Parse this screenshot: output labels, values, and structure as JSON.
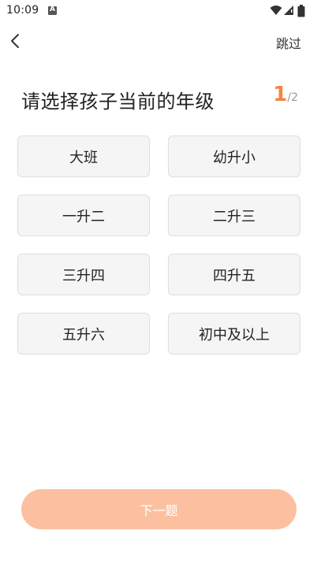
{
  "status_bar": {
    "time": "10:09",
    "icons": [
      "app-notification-icon",
      "wifi-icon",
      "signal-icon",
      "battery-icon"
    ]
  },
  "nav": {
    "back_icon": "chevron-left-icon",
    "skip_label": "跳过"
  },
  "question": {
    "title": "请选择孩子当前的年级",
    "step_current": "1",
    "step_total": "/2"
  },
  "options": [
    "大班",
    "幼升小",
    "一升二",
    "二升三",
    "三升四",
    "四升五",
    "五升六",
    "初中及以上"
  ],
  "next_button": {
    "label": "下一题",
    "color": "#fcc0a0"
  },
  "colors": {
    "accent": "#f5853f",
    "option_bg": "#f5f5f5",
    "option_border": "#dedede"
  }
}
